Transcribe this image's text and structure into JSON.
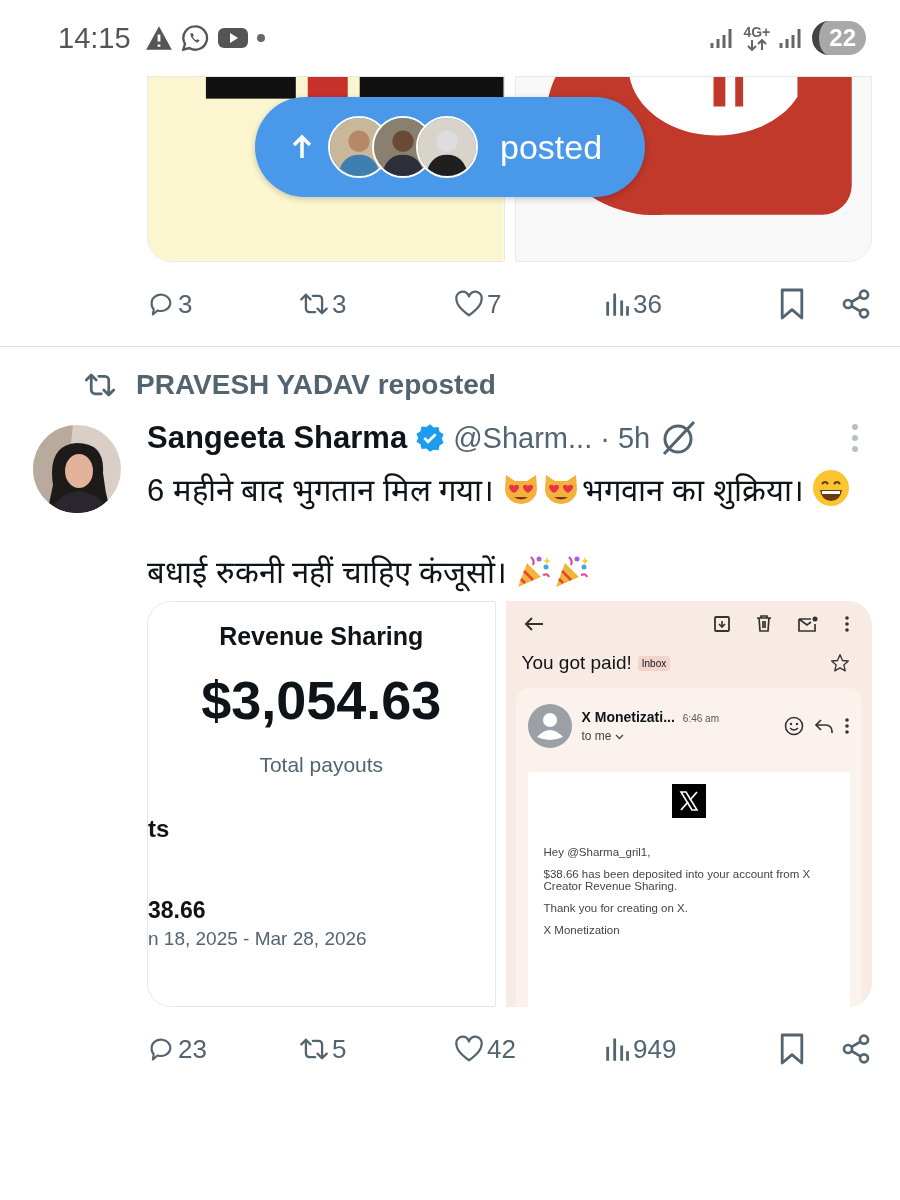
{
  "status_bar": {
    "time": "14:15",
    "network": "4G+",
    "battery": "22"
  },
  "new_posts_pill": {
    "label": "posted"
  },
  "previous_post": {
    "actions": {
      "replies": "3",
      "reposts": "3",
      "likes": "7",
      "views": "36"
    }
  },
  "post": {
    "repost_label": "PRAVESH YADAV reposted",
    "author": {
      "name": "Sangeeta Sharma",
      "verified": true,
      "handle": "@Sharm...",
      "time": "· 5h"
    },
    "body": [
      [
        {
          "kind": "text",
          "text": "6 महीने बाद भुगतान मिल गया।"
        },
        {
          "kind": "heart-eyes-cat"
        },
        {
          "kind": "heart-eyes-cat"
        },
        {
          "kind": "text",
          "text": "भगवान का शुक्रिया।"
        },
        {
          "kind": "grin"
        }
      ],
      [
        {
          "kind": "text",
          "text": "बधाई रुकनी नहीं चाहिए कंजूसों।"
        },
        {
          "kind": "party-popper"
        },
        {
          "kind": "party-popper"
        }
      ]
    ],
    "revenue_card": {
      "title": "Revenue Sharing",
      "amount": "$3,054.63",
      "caption": "Total payouts",
      "section": "ts",
      "payout": "38.66",
      "period": "n 18, 2025 - Mar 28, 2026"
    },
    "email": {
      "subject": "You got paid!",
      "label": "Inbox",
      "sender": "X Monetizati...",
      "time": "6:46 am",
      "recipient": "to me",
      "lines": [
        "Hey @Sharma_gril1,",
        "$38.66 has been deposited into your account from X Creator Revenue Sharing.",
        "Thank you for creating on X.",
        "X Monetization"
      ]
    },
    "actions": {
      "replies": "23",
      "reposts": "5",
      "likes": "42",
      "views": "949"
    }
  }
}
